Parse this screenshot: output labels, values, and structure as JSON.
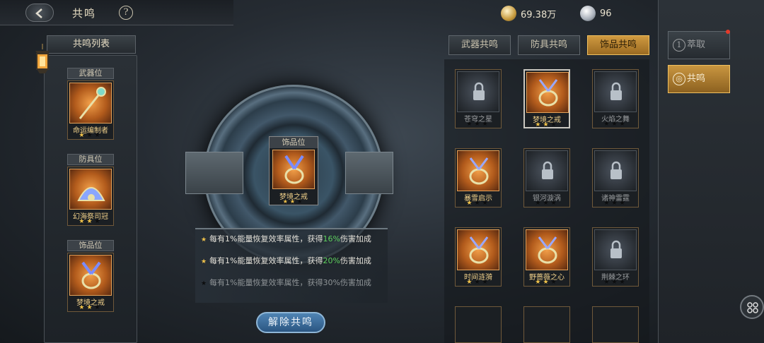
{
  "header": {
    "title": "共鸣",
    "help_symbol": "?"
  },
  "currency": [
    {
      "icon": "gold-coin-icon",
      "value": "69.38万"
    },
    {
      "icon": "silver-diamond-icon",
      "value": "96"
    }
  ],
  "left_panel": {
    "title": "共鸣列表",
    "slots": [
      {
        "label": "武器位",
        "item": "命运编制者",
        "stars": 1
      },
      {
        "label": "防具位",
        "item": "幻海祭司冠",
        "stars": 2
      },
      {
        "label": "饰品位",
        "item": "梦境之戒",
        "stars": 2
      }
    ]
  },
  "center": {
    "slot_label": "饰品位",
    "item": "梦境之戒",
    "stars": 2,
    "bonus_lines": [
      {
        "prefix": "每有1%能量恢复效率属性，获得",
        "value": "16%",
        "suffix": "伤害加成",
        "active": true
      },
      {
        "prefix": "每有1%能量恢复效率属性，获得",
        "value": "20%",
        "suffix": "伤害加成",
        "active": true
      },
      {
        "prefix": "每有1%能量恢复效率属性，获得",
        "value": "30%",
        "suffix": "伤害加成",
        "active": false
      }
    ],
    "dismiss_label": "解除共鸣"
  },
  "tabs": [
    {
      "label": "武器共鸣",
      "active": false
    },
    {
      "label": "防具共鸣",
      "active": false
    },
    {
      "label": "饰品共鸣",
      "active": true
    }
  ],
  "grid_items": [
    {
      "name": "苍穹之星",
      "stars": 0,
      "locked": true
    },
    {
      "name": "梦境之戒",
      "stars": 2,
      "locked": false,
      "selected": true
    },
    {
      "name": "火焰之舞",
      "stars": 0,
      "locked": true
    },
    {
      "name": "暴雪启示",
      "stars": 1,
      "locked": false
    },
    {
      "name": "银河漩涡",
      "stars": 0,
      "locked": true
    },
    {
      "name": "诸神雷霆",
      "stars": 0,
      "locked": true
    },
    {
      "name": "时间涟漪",
      "stars": 1,
      "locked": false
    },
    {
      "name": "野蔷薇之心",
      "stars": 2,
      "locked": false
    },
    {
      "name": "荆棘之环",
      "stars": 0,
      "locked": true
    }
  ],
  "right_tabs": [
    {
      "label": "萃取",
      "icon_text": "1",
      "active": false
    },
    {
      "label": "共鸣",
      "icon_text": "◎",
      "active": true
    }
  ],
  "colors": {
    "accent": "#d09a40",
    "bonus_green": "#5ed15e",
    "button_blue": "#3a6ea0"
  }
}
